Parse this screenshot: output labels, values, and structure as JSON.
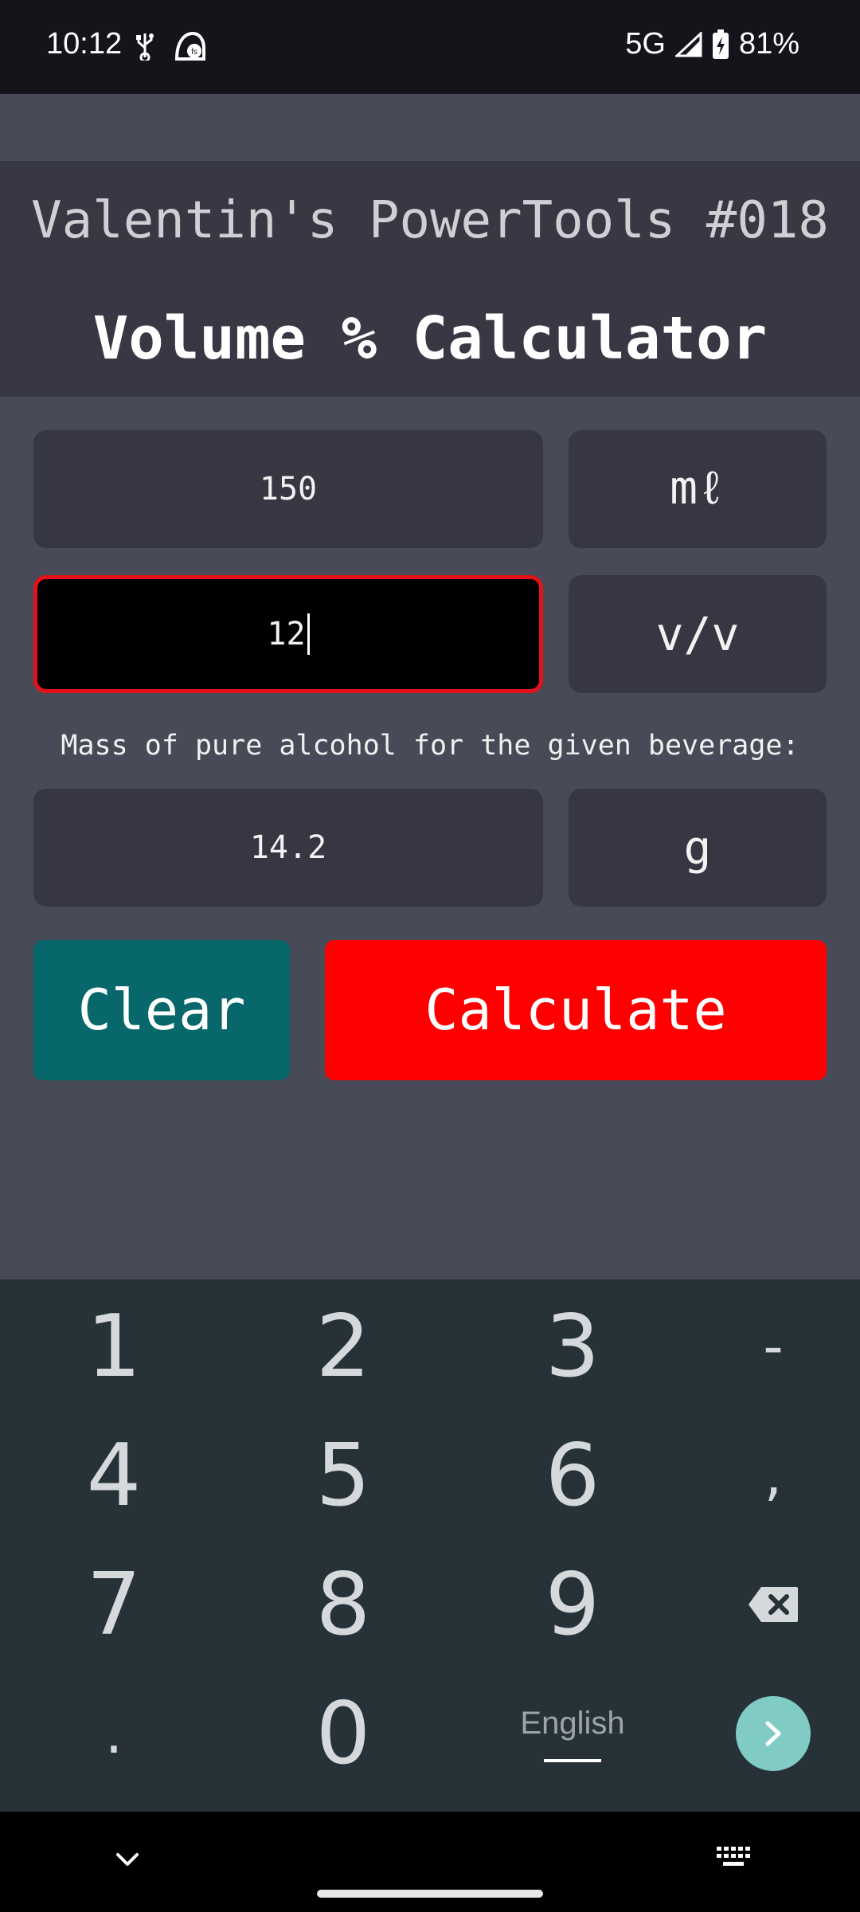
{
  "status_bar": {
    "time": "10:12",
    "network": "5G",
    "battery": "81%",
    "icons": [
      "usb-icon",
      "app-notification-icon",
      "signal-icon",
      "battery-charging-icon"
    ]
  },
  "header": {
    "brand": "Valentin's PowerTools #018",
    "title": "Volume % Calculator"
  },
  "form": {
    "volume_value": "150",
    "volume_unit": "mℓ",
    "percent_value": "12",
    "percent_unit": "v/v",
    "result_label": "Mass of pure alcohol for the given beverage:",
    "result_value": "14.2",
    "result_unit": "g"
  },
  "buttons": {
    "clear": "Clear",
    "calculate": "Calculate"
  },
  "colors": {
    "accent_red": "#ff0000",
    "clear_teal": "#08676a",
    "active_border": "#e3121a",
    "keyboard_bg": "#263238",
    "enter_key": "#80cbc4"
  },
  "keyboard": {
    "keys": [
      "1",
      "2",
      "3",
      "-",
      "4",
      "5",
      "6",
      ",",
      "7",
      "8",
      "9",
      "backspace",
      ".",
      "0",
      "English",
      "enter"
    ],
    "k1": "1",
    "k2": "2",
    "k3": "3",
    "kminus": "-",
    "k4": "4",
    "k5": "5",
    "k6": "6",
    "kcomma": ",",
    "k7": "7",
    "k8": "8",
    "k9": "9",
    "kdot": ".",
    "k0": "0",
    "language": "English"
  }
}
